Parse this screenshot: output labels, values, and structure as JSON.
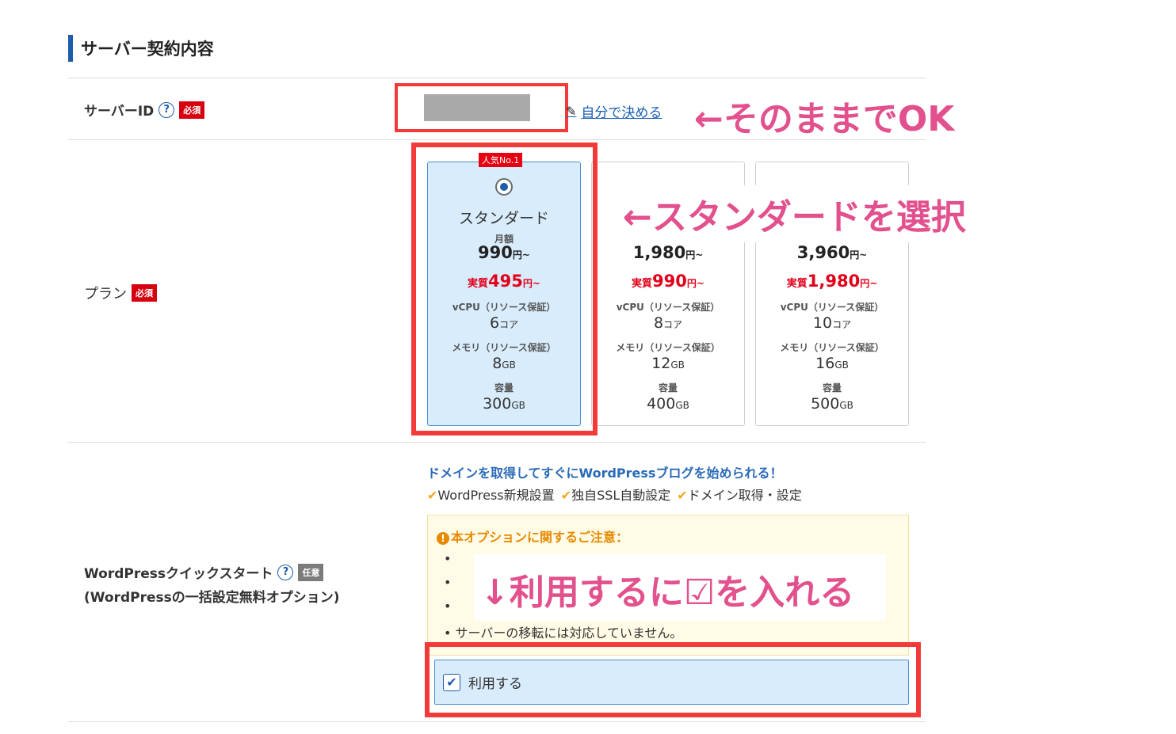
{
  "section": {
    "title": "サーバー契約内容"
  },
  "server_id": {
    "label": "サーバーID",
    "help": "?",
    "required": "必須",
    "edit_link": "自分で決める"
  },
  "plan": {
    "label": "プラン",
    "required": "必須",
    "popular_badge": "人気No.1",
    "monthly_label": "月額",
    "effective_prefix": "実質",
    "yen_suffix": "円~",
    "cpu_label": "vCPU（リソース保証）",
    "memory_label": "メモリ（リソース保証）",
    "storage_label": "容量",
    "core_unit": "コア",
    "gb_unit": "GB",
    "items": [
      {
        "name": "スタンダード",
        "price": "990",
        "effective": "495",
        "cpu": "6",
        "memory": "8",
        "storage": "300",
        "selected": true
      },
      {
        "price": "1,980",
        "effective": "990",
        "cpu": "8",
        "memory": "12",
        "storage": "400",
        "selected": false
      },
      {
        "price": "3,960",
        "effective": "1,980",
        "cpu": "10",
        "memory": "16",
        "storage": "500",
        "selected": false
      }
    ]
  },
  "wordpress": {
    "label": "WordPressクイックスタート",
    "sublabel": "(WordPressの一括設定無料オプション)",
    "help": "?",
    "optional": "任意",
    "promo": "ドメインを取得してすぐにWordPressブログを始められる！",
    "features": [
      "WordPress新規設置",
      "独自SSL自動設定",
      "ドメイン取得・設定"
    ],
    "notice_title": "本オプションに関するご注意：",
    "notice_items": [
      "•",
      "•",
      "•",
      "• サーバーの移転には対応していません。"
    ],
    "use_label": "利用する",
    "use_checked": true
  },
  "annotations": {
    "keep_ok": "←そのままでOK",
    "select_standard": "←スタンダードを選択",
    "check_use": "↓利用するに☑を入れる"
  },
  "colors": {
    "accent_blue": "#1e5dab",
    "required_red": "#d7000f",
    "annotation_pink": "#e2508d",
    "highlight_red": "#f23a3a"
  }
}
